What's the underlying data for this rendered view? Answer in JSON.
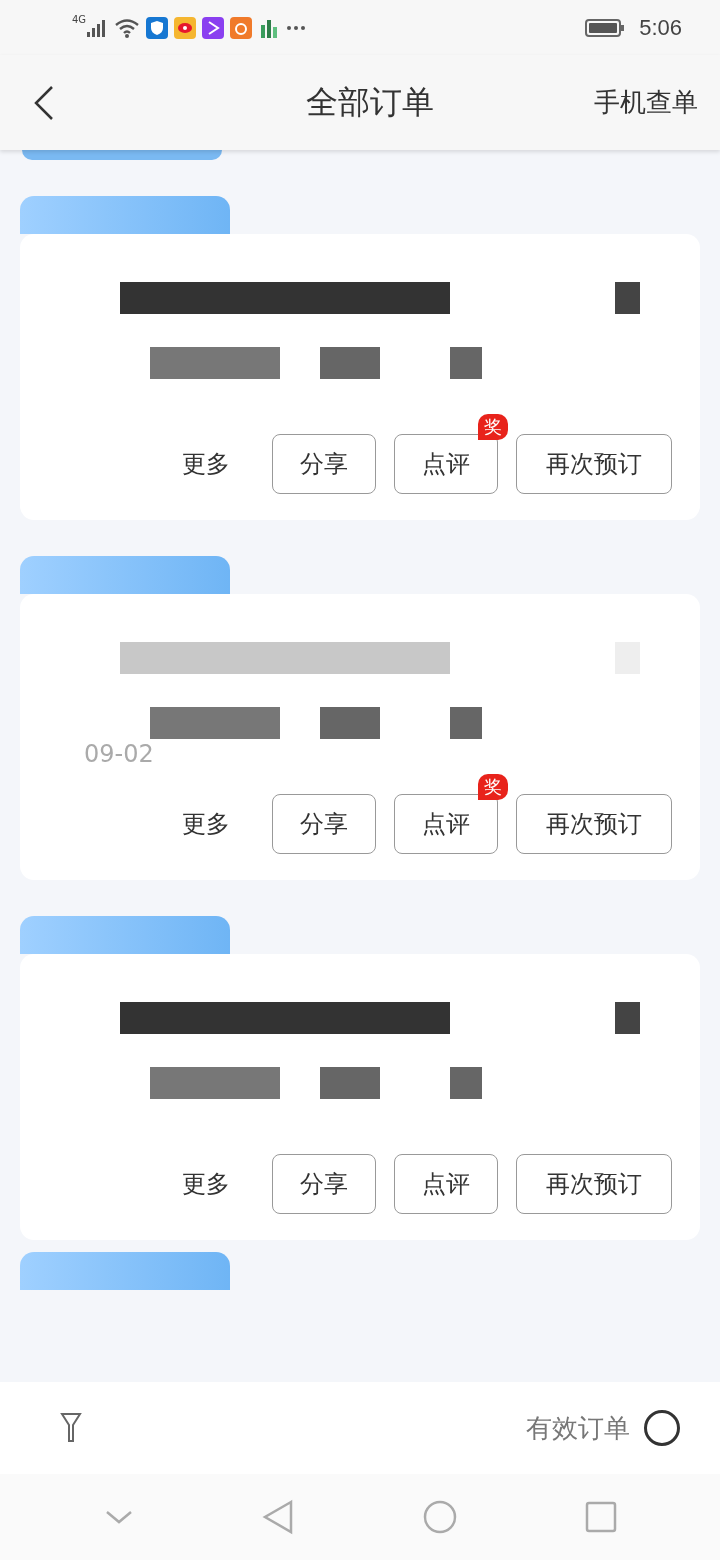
{
  "status_bar": {
    "network": "4G",
    "time": "5:06"
  },
  "header": {
    "title": "全部订单",
    "action": "手机查单"
  },
  "orders": [
    {
      "buttons": [
        {
          "label": "更多",
          "kind": "text"
        },
        {
          "label": "分享",
          "kind": "outline"
        },
        {
          "label": "点评",
          "kind": "outline",
          "badge": "奖"
        },
        {
          "label": "再次预订",
          "kind": "outline"
        }
      ]
    },
    {
      "date_text": "09-02",
      "buttons": [
        {
          "label": "更多",
          "kind": "text"
        },
        {
          "label": "分享",
          "kind": "outline"
        },
        {
          "label": "点评",
          "kind": "outline",
          "badge": "奖"
        },
        {
          "label": "再次预订",
          "kind": "outline"
        }
      ]
    },
    {
      "buttons": [
        {
          "label": "更多",
          "kind": "text"
        },
        {
          "label": "分享",
          "kind": "outline"
        },
        {
          "label": "点评",
          "kind": "outline"
        },
        {
          "label": "再次预订",
          "kind": "outline"
        }
      ]
    }
  ],
  "filter_bar": {
    "valid_only": {
      "label": "有效订单",
      "on": false
    }
  }
}
